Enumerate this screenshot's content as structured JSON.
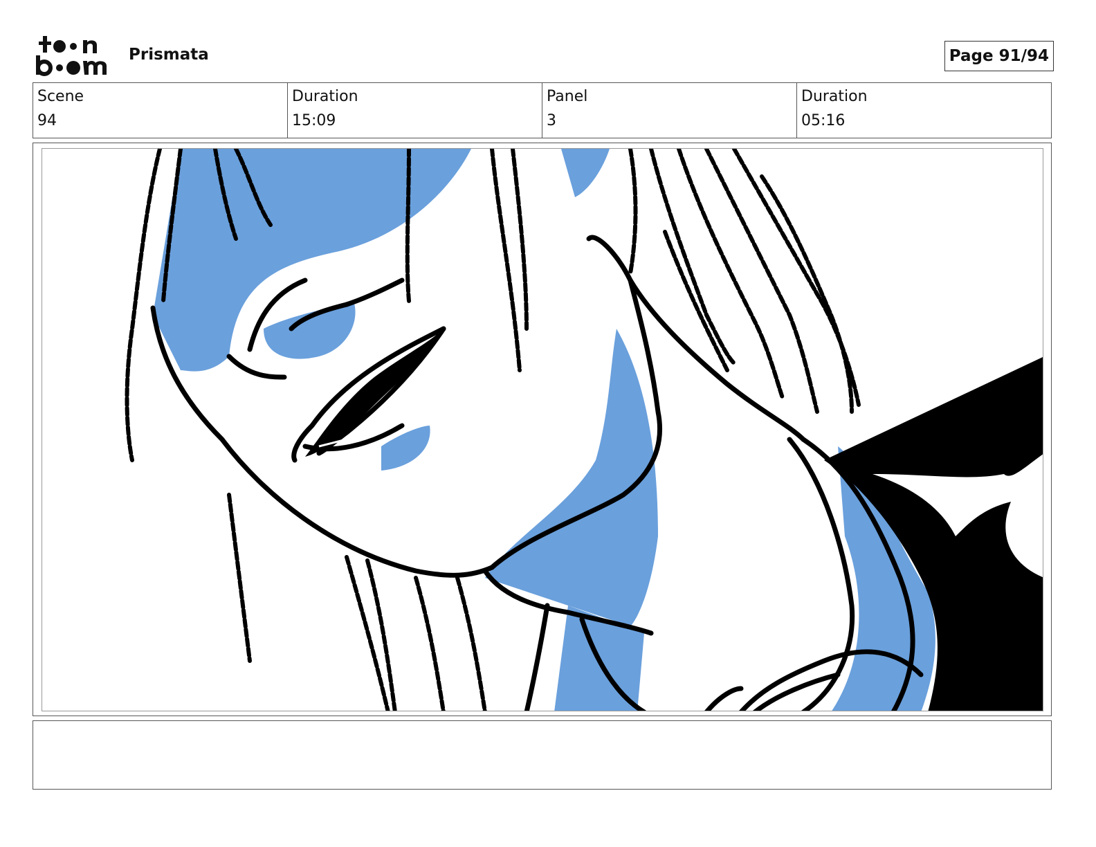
{
  "header": {
    "logo_name": "toon-boom-logo",
    "project_title": "Prismata",
    "page_label": "Page 91/94"
  },
  "info": {
    "scene_label": "Scene",
    "scene_value": "94",
    "scene_duration_label": "Duration",
    "scene_duration_value": "15:09",
    "panel_label": "Panel",
    "panel_value": "3",
    "panel_duration_label": "Duration",
    "panel_duration_value": "05:16"
  },
  "panel": {
    "image_name": "character-closeup-sketch",
    "colors": {
      "shadow": "#6aa0dc",
      "ink": "#000000",
      "paper": "#ffffff"
    }
  },
  "notes": {
    "text": ""
  }
}
